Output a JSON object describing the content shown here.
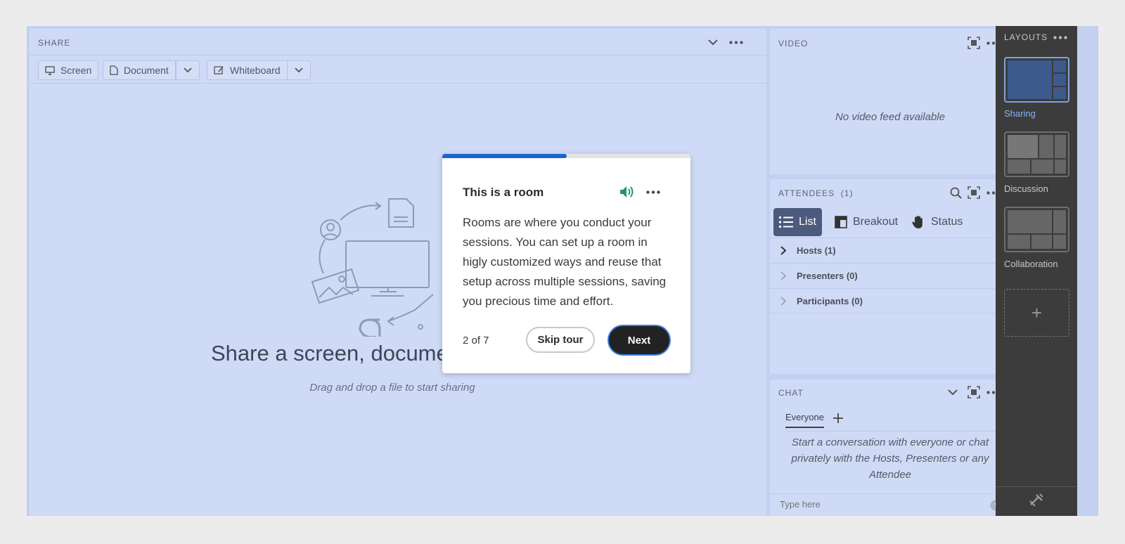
{
  "share": {
    "title": "SHARE",
    "toolbar": {
      "screen": "Screen",
      "document": "Document",
      "whiteboard": "Whiteboard"
    },
    "empty_title": "Share a screen, documen",
    "empty_subtitle": "Drag and drop a file to start sharing"
  },
  "video": {
    "title": "VIDEO",
    "empty": "No video feed available"
  },
  "attendees": {
    "title": "ATTENDEES",
    "count": "(1)",
    "tabs": {
      "list": "List",
      "breakout": "Breakout",
      "status": "Status"
    },
    "groups": [
      "Hosts (1)",
      "Presenters (0)",
      "Participants (0)"
    ]
  },
  "chat": {
    "title": "CHAT",
    "tab": "Everyone",
    "empty": "Start a conversation with everyone or chat privately with the Hosts, Presenters or any Attendee",
    "placeholder": "Type here"
  },
  "layouts": {
    "title": "LAYOUTS",
    "items": [
      {
        "label": "Sharing",
        "active": true
      },
      {
        "label": "Discussion",
        "active": false
      },
      {
        "label": "Collaboration",
        "active": false
      }
    ],
    "add": "+"
  },
  "tour": {
    "title": "This is a room",
    "body": "Rooms are where you conduct your sessions. You can set up a room in higly customized ways and reuse that setup across multiple sessions, saving you precious time and effort.",
    "step": "2 of 7",
    "progress": 0.5,
    "skip_label": "Skip tour",
    "next_label": "Next"
  },
  "colors": {
    "accent": "#1b64d0",
    "pod_bg": "#cfdaf6",
    "layouts_bg": "#3c3c3c",
    "active_layout": "#8db2ef",
    "speaker_green": "#1e9a62"
  }
}
